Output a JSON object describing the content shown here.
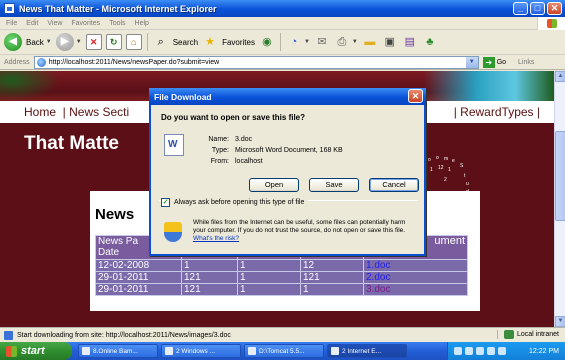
{
  "window": {
    "title": "News That Matter - Microsoft Internet Explorer",
    "minimize": "_",
    "maximize": "□",
    "close": "✕"
  },
  "menu": [
    "File",
    "Edit",
    "View",
    "Favorites",
    "Tools",
    "Help"
  ],
  "toolbar": {
    "back_label": "Back",
    "search_label": "Search",
    "favorites_label": "Favorites"
  },
  "address": {
    "label": "Address",
    "url": "http://localhost:2011/News/newsPaper.do?submit=view",
    "go_label": "Go",
    "links_label": "Links"
  },
  "page": {
    "nav_left": "Home  | News Secti",
    "nav_right": "| RewardTypes  |",
    "site_title": "That Matte",
    "panel_title": "News",
    "table": {
      "header": [
        "News Pa\nDate",
        "",
        "",
        "",
        "ument"
      ],
      "rows": [
        {
          "date": "12-02-2008",
          "c2": "1",
          "c3": "1",
          "c4": "12",
          "doc": "1.doc",
          "visited": false
        },
        {
          "date": "29-01-2011",
          "c2": "121",
          "c3": "1",
          "c4": "121",
          "doc": "2.doc",
          "visited": false
        },
        {
          "date": "29-01-2011",
          "c2": "121",
          "c3": "1",
          "c4": "1",
          "doc": "3.doc",
          "visited": true
        }
      ]
    }
  },
  "dialog": {
    "title": "File Download",
    "close": "✕",
    "question": "Do you want to open or save this file?",
    "name_label": "Name:",
    "name_value": "3.doc",
    "type_label": "Type:",
    "type_value": "Microsoft Word Document, 168 KB",
    "from_label": "From:",
    "from_value": "localhost",
    "open_label": "Open",
    "save_label": "Save",
    "cancel_label": "Cancel",
    "checkbox_label": "Always ask before opening this type of file",
    "checkbox_checked": "✓",
    "warning_text": "While files from the Internet can be useful, some files can potentially harm your computer. If you do not trust the source, do not open or save this file.",
    "warning_link": "What's the risk?"
  },
  "status": {
    "text": "Start downloading from site: http://localhost:2011/News/images/3.doc",
    "zone": "Local intranet"
  },
  "taskbar": {
    "start_label": "start",
    "tasks": [
      "8.Online Bam...",
      "2 Windows ...",
      "D:\\Tomcat 5.5...",
      "2 Internet E..."
    ],
    "clock": "12:22 PM"
  }
}
